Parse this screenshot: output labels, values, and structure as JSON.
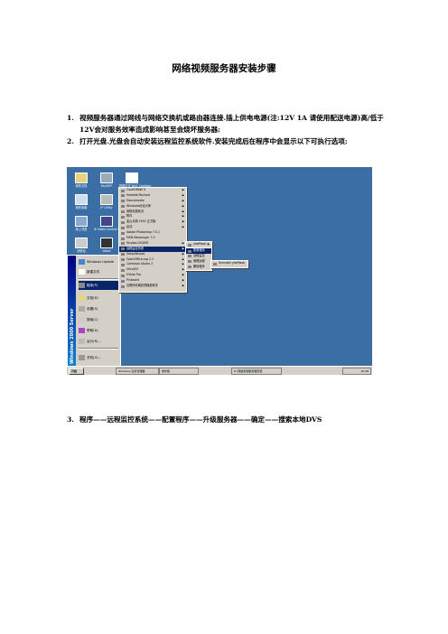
{
  "document": {
    "title": "网络视频服务器安装步骤",
    "items": [
      {
        "num": "1.",
        "text": "视频服务器通过网线与网络交换机或路由器连接.插上供电电源(注:12V 1A 请使用配送电源)高/低于12V会对服务效率造成影响甚至会烧坏服务器;"
      },
      {
        "num": "2.",
        "text": "打开光盘.光盘会自动安装远程监控系统软件.安装完成后在程序中会显示以下可执行选项;"
      },
      {
        "num": "3.",
        "text": "程序——远程监控系统——配置程序——升级服务器——确定——搜索本地DVS"
      }
    ]
  },
  "screenshot": {
    "desktop_icons": [
      {
        "label": "我的文档"
      },
      {
        "label": "KeyDVP"
      },
      {
        "label": "快捷方式 NVS_Configer"
      },
      {
        "label": "我的电脑"
      },
      {
        "label": "IP Utility"
      },
      {
        "label": "快捷方式 Web.update"
      },
      {
        "label": "网上邻居"
      },
      {
        "label": "IE Video Control Center"
      },
      {
        "label": "回收站"
      },
      {
        "label": "iddvd"
      },
      {
        "label": "Internet Explorer"
      },
      {
        "label": "LeapFTP"
      },
      {
        "label": "在线服务"
      },
      {
        "label": "FlashGet"
      }
    ],
    "start_menu": [
      {
        "label": "Windows Update"
      },
      {
        "label": "新建文件"
      },
      {
        "label": "程序(P)"
      },
      {
        "label": "文档(D)"
      },
      {
        "label": "设置(S)"
      },
      {
        "label": "搜索(C)"
      },
      {
        "label": "帮助(H)"
      },
      {
        "label": "运行(R)..."
      },
      {
        "label": "关机(U)..."
      }
    ],
    "side_banner": "Windows 2000 Server",
    "programs": [
      "CorelDRAW 9",
      "Hewlett-Packard",
      "Macromedia",
      "Windows优化大师",
      "网络电视精灵",
      "附件",
      "金山毒霸 2002 正式版",
      "启动",
      "Adobe Photoshop 7.0.1",
      "MSN Messenger 7.0",
      "Youdao DICKER",
      "远程监控系统",
      "SetupWizard",
      "OpenOffice.org 2.3",
      "Camtasia Studio 3",
      "UltraISO",
      "EVista Pro",
      "Pinboard",
      "互联网光碟影视播放软件"
    ],
    "vendor_menu": [
      "yfwfflash"
    ],
    "remote_menu": [
      "配置程序",
      "远程监控",
      "管理远程",
      "删除程序"
    ],
    "vendor_tooltip": "Uninstall yfwfflash",
    "taskbar": {
      "start": "开始",
      "tasks": [
        "Windows 任务管理器",
        "收件箱",
        "D:\\网络视频服务器安装"
      ],
      "clock": "10:48"
    }
  }
}
